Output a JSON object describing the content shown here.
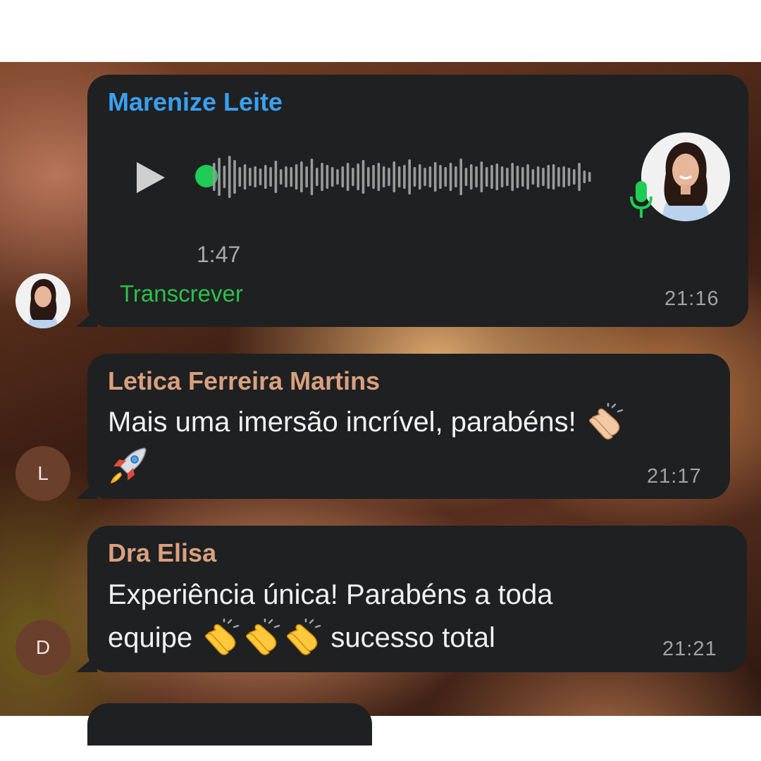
{
  "messages": [
    {
      "sender": "Marenize Leite",
      "sender_color": "#3aa0f2",
      "type": "voice",
      "duration": "1:47",
      "transcribe_label": "Transcrever",
      "time": "21:16",
      "avatar_icon": "profile-photo-woman",
      "mic_icon": "microphone-icon",
      "mic_color": "#1fcc55"
    },
    {
      "sender": "Letica Ferreira Martins",
      "sender_color": "#d9a07f",
      "type": "text",
      "line1": "Mais uma imersão incrível, parabéns!",
      "line1_emoji": "clapping-hands",
      "line2_emoji": "rocket",
      "time": "21:17",
      "avatar_letter": "L"
    },
    {
      "sender": "Dra Elisa",
      "sender_color": "#d9a07f",
      "type": "text",
      "line1": "Experiência única! Parabéns a toda",
      "line2_pre": "equipe",
      "line2_emojis": [
        "clapping-hands",
        "clapping-hands",
        "clapping-hands"
      ],
      "line2_post": "sucesso total",
      "time": "21:21",
      "avatar_letter": "D"
    }
  ]
}
